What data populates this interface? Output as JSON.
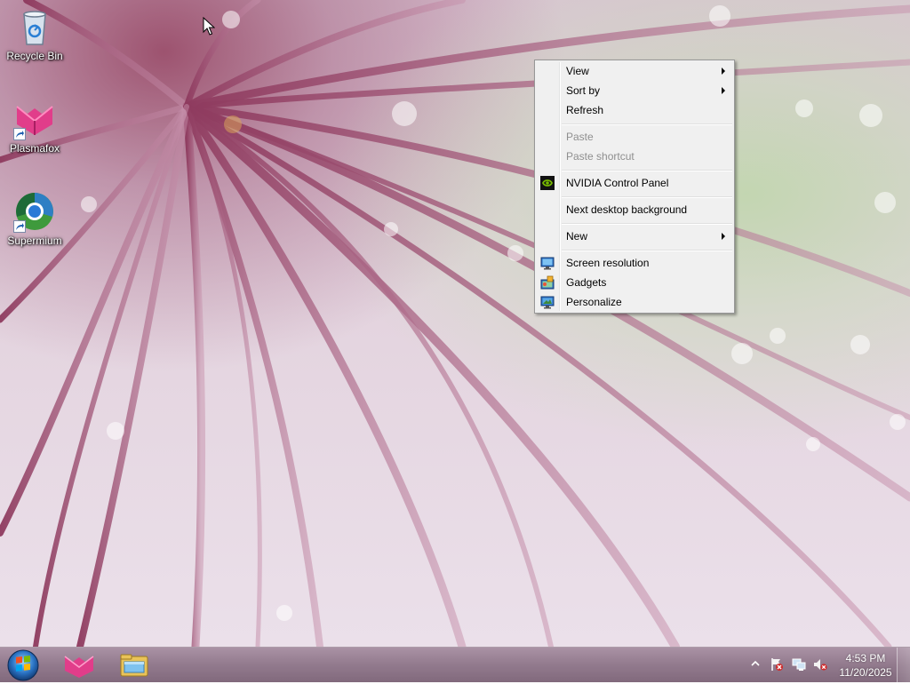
{
  "desktop": {
    "icons": [
      {
        "label": "Recycle Bin",
        "icon": "recycle-bin-icon"
      },
      {
        "label": "Plasmafox",
        "icon": "plasmafox-icon"
      },
      {
        "label": "Supermium",
        "icon": "supermium-icon"
      }
    ]
  },
  "context_menu": {
    "items": [
      {
        "label": "View",
        "has_submenu": true
      },
      {
        "label": "Sort by",
        "has_submenu": true
      },
      {
        "label": "Refresh"
      },
      {
        "label": "Paste",
        "disabled": true
      },
      {
        "label": "Paste shortcut",
        "disabled": true
      },
      {
        "label": "NVIDIA Control Panel",
        "icon": "nvidia-icon"
      },
      {
        "label": "Next desktop background"
      },
      {
        "label": "New",
        "has_submenu": true
      },
      {
        "label": "Screen resolution",
        "icon": "monitor-icon"
      },
      {
        "label": "Gadgets",
        "icon": "gadgets-icon"
      },
      {
        "label": "Personalize",
        "icon": "personalize-icon"
      }
    ]
  },
  "taskbar": {
    "pinned": [
      "plasmafox-icon",
      "file-explorer-icon"
    ],
    "tray_icons": [
      "action-center-icon",
      "network-icon",
      "volume-muted-icon"
    ],
    "clock": {
      "time": "4:53 PM",
      "date": "11/20/2025"
    }
  },
  "colors": {
    "menu_bg": "#f0f0f0",
    "menu_border": "#979797",
    "disabled_text": "#8f8f8f"
  }
}
